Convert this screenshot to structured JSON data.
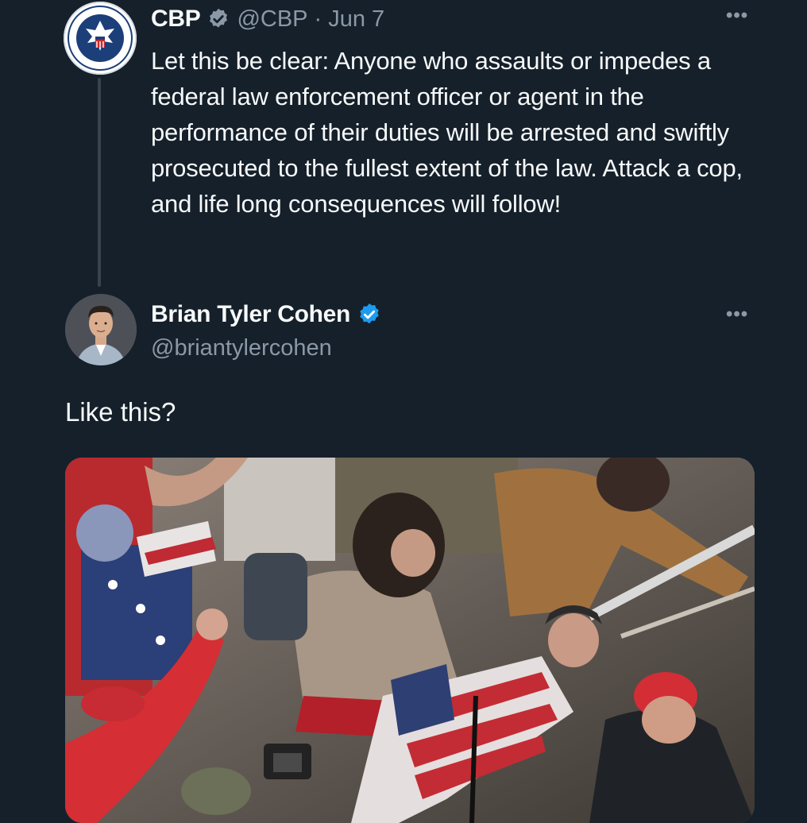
{
  "original_tweet": {
    "author_name": "CBP",
    "handle": "@CBP",
    "separator": "·",
    "date": "Jun 7",
    "text": "Let this be clear: Anyone who assaults or impedes a federal law enforcement officer or agent in the performance of their duties will be arrested and swiftly prosecuted to the fullest extent of the law. Attack a cop, and life long consequences will follow!",
    "more_label": "•••"
  },
  "reply_tweet": {
    "author_name": "Brian Tyler Cohen",
    "handle": "@briantylercohen",
    "text": "Like this?",
    "more_label": "•••"
  },
  "colors": {
    "background": "#15202b",
    "verified_gray": "#8b98a5",
    "verified_blue": "#1d9bf0",
    "text_primary": "#f7f9f9",
    "text_secondary": "#8b98a5"
  }
}
